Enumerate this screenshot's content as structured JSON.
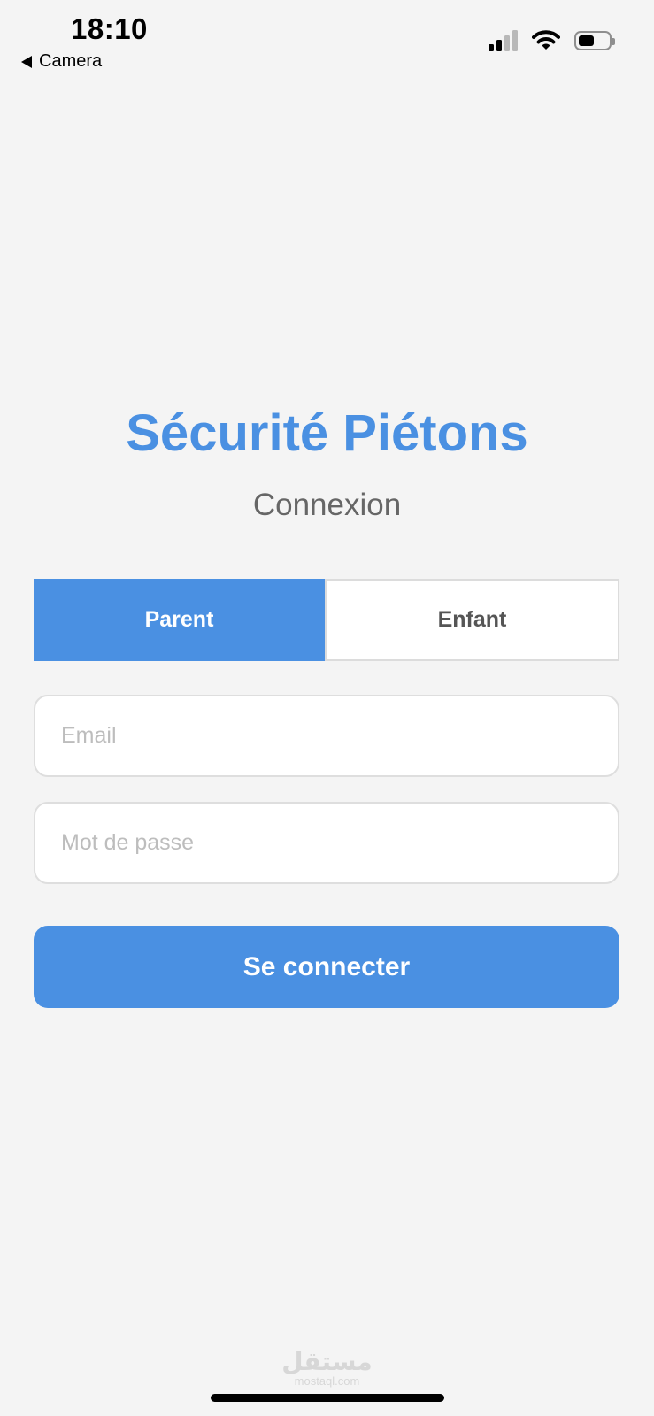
{
  "status_bar": {
    "time": "18:10",
    "back_label": "Camera",
    "battery_level": 0.55
  },
  "app": {
    "title": "Sécurité Piétons",
    "subtitle": "Connexion"
  },
  "role_toggle": {
    "options": [
      {
        "label": "Parent",
        "selected": true
      },
      {
        "label": "Enfant",
        "selected": false
      }
    ]
  },
  "form": {
    "email": {
      "value": "",
      "placeholder": "Email"
    },
    "password": {
      "value": "",
      "placeholder": "Mot de passe"
    },
    "submit_label": "Se connecter"
  },
  "watermark": {
    "arabic": "مستقل",
    "url": "mostaql.com"
  },
  "colors": {
    "accent": "#4a90e2",
    "background": "#f4f4f4",
    "muted_text": "#666666"
  }
}
